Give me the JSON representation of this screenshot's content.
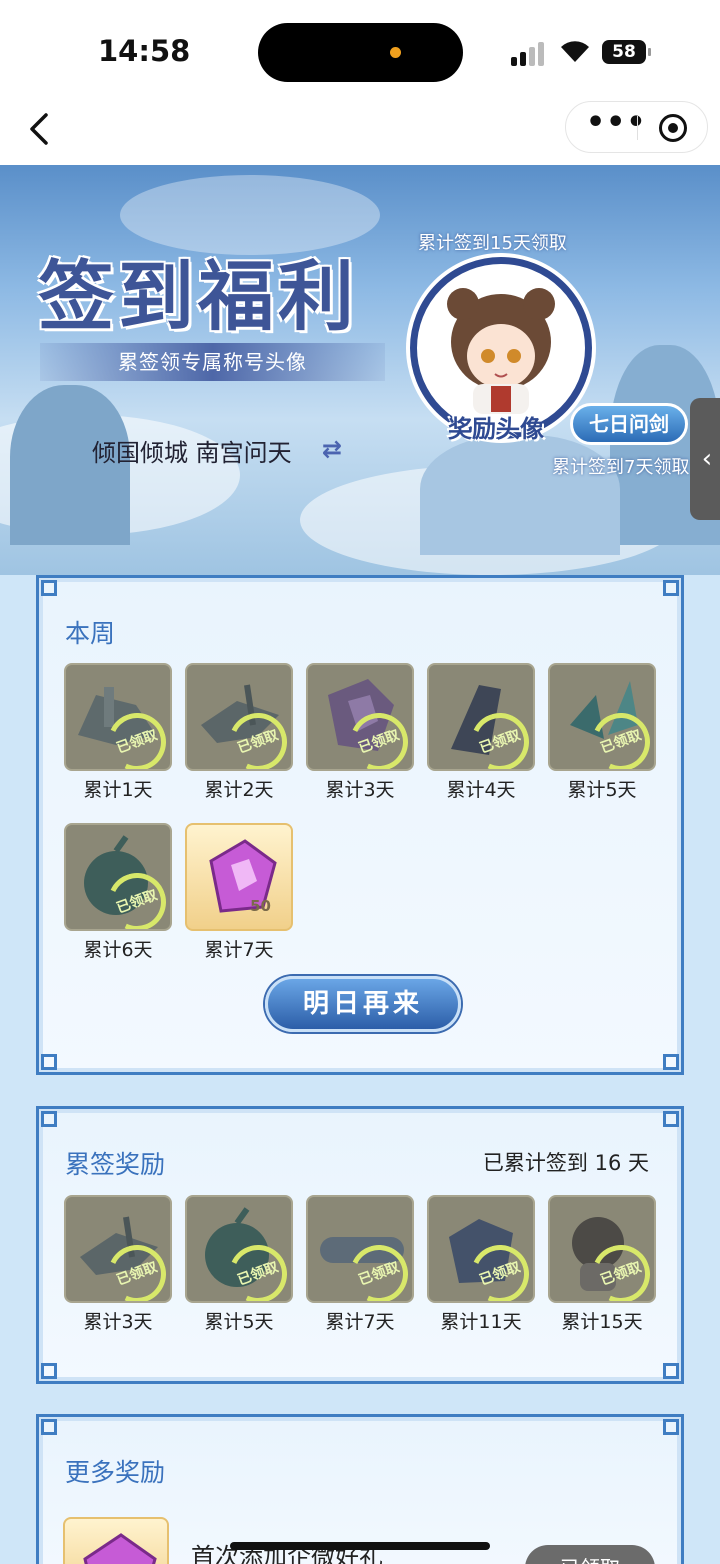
{
  "status_bar": {
    "time": "14:58",
    "battery": "58"
  },
  "nav": {
    "back_icon": "chevron-left-icon",
    "more_icon": "more-dots-icon",
    "close_icon": "target-circle-icon"
  },
  "hero": {
    "title": "签到福利",
    "subtitle": "累签领专属称号头像",
    "server_line": "倾国倾城 南宫问天",
    "cum15_text": "累计签到15天领取",
    "avatar_label": "奖励头像",
    "title_badge": "七日问剑",
    "cum7_text": "累计签到7天领取"
  },
  "weekly": {
    "title": "本周",
    "claimed_stamp": "已领取",
    "items": [
      {
        "label": "累计1天",
        "claimed": true
      },
      {
        "label": "累计2天",
        "claimed": true
      },
      {
        "label": "累计3天",
        "claimed": true
      },
      {
        "label": "累计4天",
        "claimed": true
      },
      {
        "label": "累计5天",
        "claimed": true
      },
      {
        "label": "累计6天",
        "claimed": true
      },
      {
        "label": "累计7天",
        "claimed": false,
        "count": "50"
      }
    ],
    "button": "明日再来"
  },
  "cumulative": {
    "title": "累签奖励",
    "summary": "已累计签到 16 天",
    "claimed_stamp": "已领取",
    "items": [
      {
        "label": "累计3天",
        "claimed": true
      },
      {
        "label": "累计5天",
        "claimed": true
      },
      {
        "label": "累计7天",
        "claimed": true
      },
      {
        "label": "累计11天",
        "claimed": true
      },
      {
        "label": "累计15天",
        "claimed": true
      }
    ]
  },
  "more": {
    "title": "更多奖励",
    "item_text": "首次添加企微好礼",
    "item_button": "已领取"
  },
  "colors": {
    "accent": "#3a72bd",
    "panel_border": "#3f7dc2",
    "stamp": "#d8e86a"
  }
}
